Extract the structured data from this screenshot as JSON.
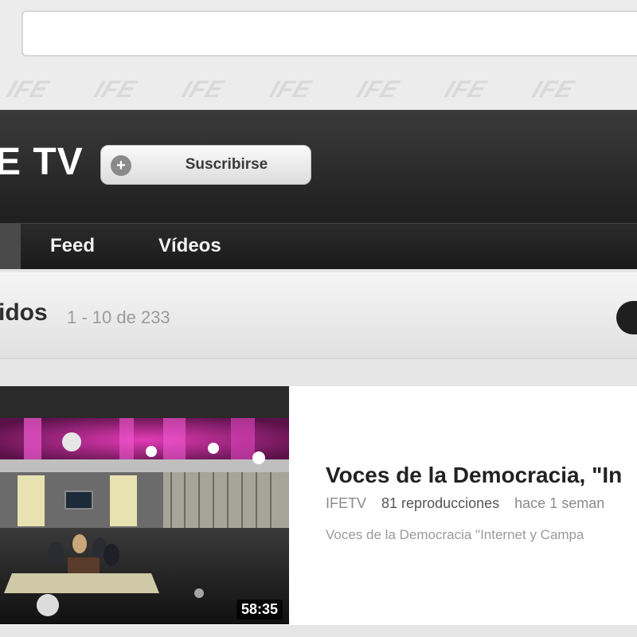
{
  "search": {
    "value": ""
  },
  "banner": {
    "watermark_text": "IFE"
  },
  "channel": {
    "name": "E TV",
    "subscribe_label": "Suscribirse"
  },
  "tabs": [
    {
      "label": "Feed"
    },
    {
      "label": "Vídeos"
    }
  ],
  "list_header": {
    "title": "idos",
    "count": "1 - 10 de 233"
  },
  "video": {
    "title": "Voces de la Democracia, \"In",
    "channel": "IFETV",
    "views": "81 reproducciones",
    "age": "hace 1 seman",
    "description": "Voces de la Democracia \"Internet y Campa",
    "duration": "58:35"
  },
  "colors": {
    "header_dark": "#1f1f1f",
    "studio_magenta": "#c0209a",
    "text_dark": "#222222",
    "text_muted": "#8a8a8a"
  }
}
